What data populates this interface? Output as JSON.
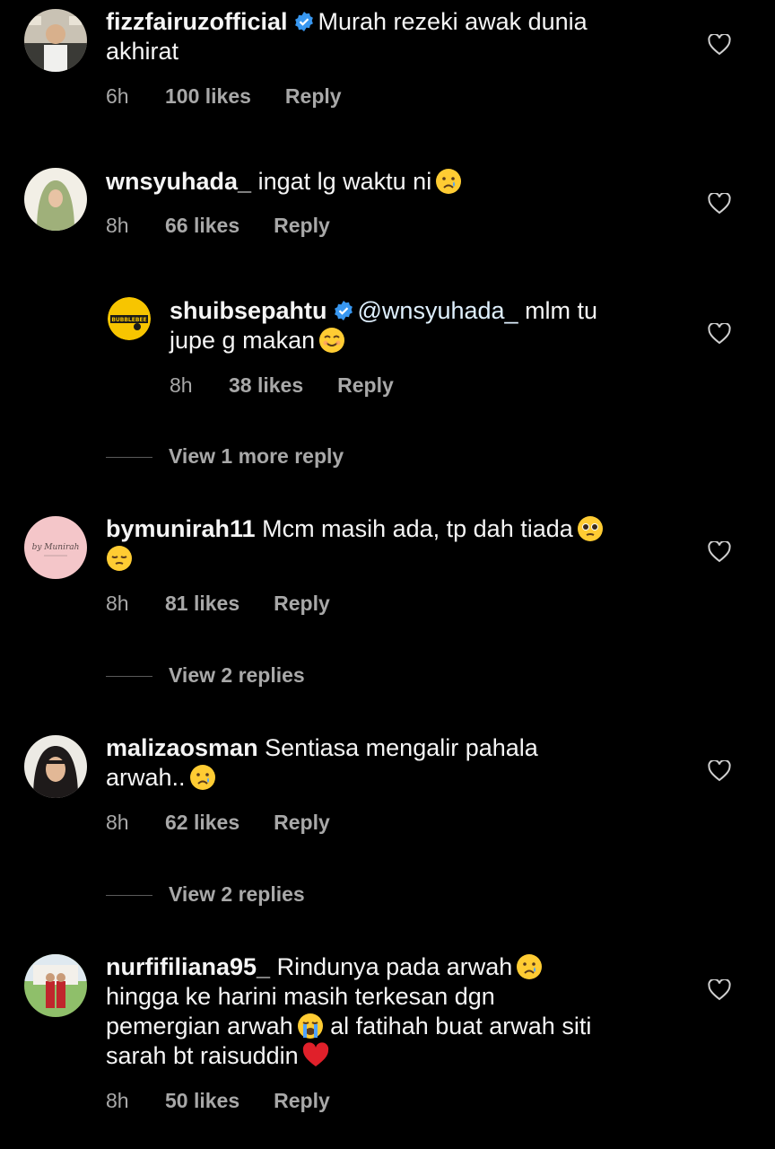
{
  "comments": [
    {
      "username": "fizzfairuzofficial",
      "verified": true,
      "text_line1": "Murah rezeki awak dunia",
      "text_line2": "akhirat",
      "time": "6h",
      "likes": "100 likes",
      "reply": "Reply"
    },
    {
      "username": "wnsyuhada_",
      "verified": false,
      "text_line1": "ingat lg waktu ni",
      "time": "8h",
      "likes": "66 likes",
      "reply": "Reply"
    },
    {
      "username": "bymunirah11",
      "verified": false,
      "text_line1": "Mcm masih ada, tp dah tiada",
      "time": "8h",
      "likes": "81 likes",
      "reply": "Reply",
      "view_replies": "View 2 replies",
      "avatar_text": "by Munirah"
    },
    {
      "username": "malizaosman",
      "verified": false,
      "text_line1": "Sentiasa mengalir pahala",
      "text_line2": "arwah..",
      "time": "8h",
      "likes": "62 likes",
      "reply": "Reply",
      "view_replies": "View 2 replies"
    },
    {
      "username": "nurfifiliana95_",
      "verified": false,
      "text_line1": "Rindunya pada arwah",
      "text_line2": "hingga ke harini masih terkesan dgn",
      "text_line3a": "pemergian arwah",
      "text_line3b": "al fatihah buat arwah siti",
      "text_line4": "sarah bt raisuddin",
      "time": "8h",
      "likes": "50 likes",
      "reply": "Reply"
    }
  ],
  "reply": {
    "username": "shuibsepahtu",
    "verified": true,
    "mention": "@wnsyuhada_",
    "text_line1": "mlm tu",
    "text_line2": "jupe g makan",
    "time": "8h",
    "likes": "38 likes",
    "reply": "Reply",
    "view_more": "View 1 more reply",
    "avatar_text": "BUBBLEBEE"
  },
  "icons": {
    "heart": "heart-outline-icon",
    "verified": "verified-badge-icon",
    "emoji_crying": "crying-face-emoji",
    "emoji_smiling": "smiling-face-emoji",
    "emoji_pleading": "pleading-face-emoji",
    "emoji_pensive": "pensive-face-emoji",
    "emoji_sobbing": "sobbing-face-emoji",
    "emoji_heart": "red-heart-emoji"
  },
  "colors": {
    "background": "#000000",
    "text": "#f5f5f5",
    "secondary": "#a8a8a8",
    "verified": "#3897f0"
  }
}
